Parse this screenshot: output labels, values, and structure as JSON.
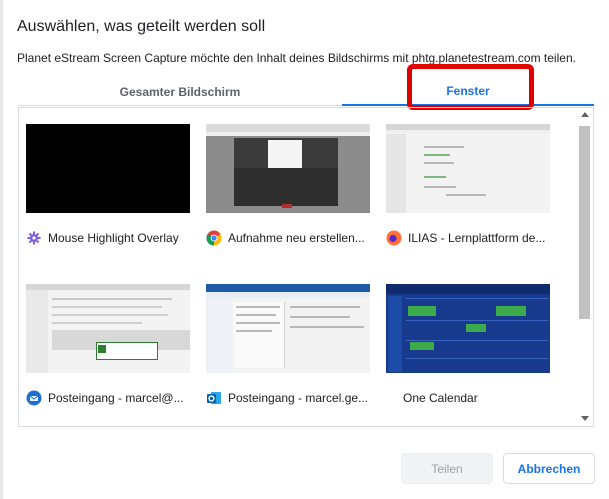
{
  "dialog": {
    "title": "Auswählen, was geteilt werden soll",
    "subtitle": "Planet eStream Screen Capture möchte den Inhalt deines Bildschirms mit phtg.planetestream.com teilen."
  },
  "tabs": [
    {
      "label": "Gesamter Bildschirm",
      "selected": false
    },
    {
      "label": "Fenster",
      "selected": true
    }
  ],
  "windows": [
    {
      "label": "Mouse Highlight Overlay",
      "icon": "gear-icon"
    },
    {
      "label": "Aufnahme neu erstellen...",
      "icon": "chrome-icon"
    },
    {
      "label": "ILIAS - Lernplattform de...",
      "icon": "firefox-icon"
    },
    {
      "label": "Posteingang - marcel@...",
      "icon": "thunderbird-icon"
    },
    {
      "label": "Posteingang - marcel.ge...",
      "icon": "outlook-icon"
    },
    {
      "label": "One Calendar",
      "icon": ""
    }
  ],
  "buttons": {
    "share": "Teilen",
    "cancel": "Abbrechen"
  },
  "colors": {
    "accent": "#1a73e8",
    "highlight": "#e00000"
  }
}
